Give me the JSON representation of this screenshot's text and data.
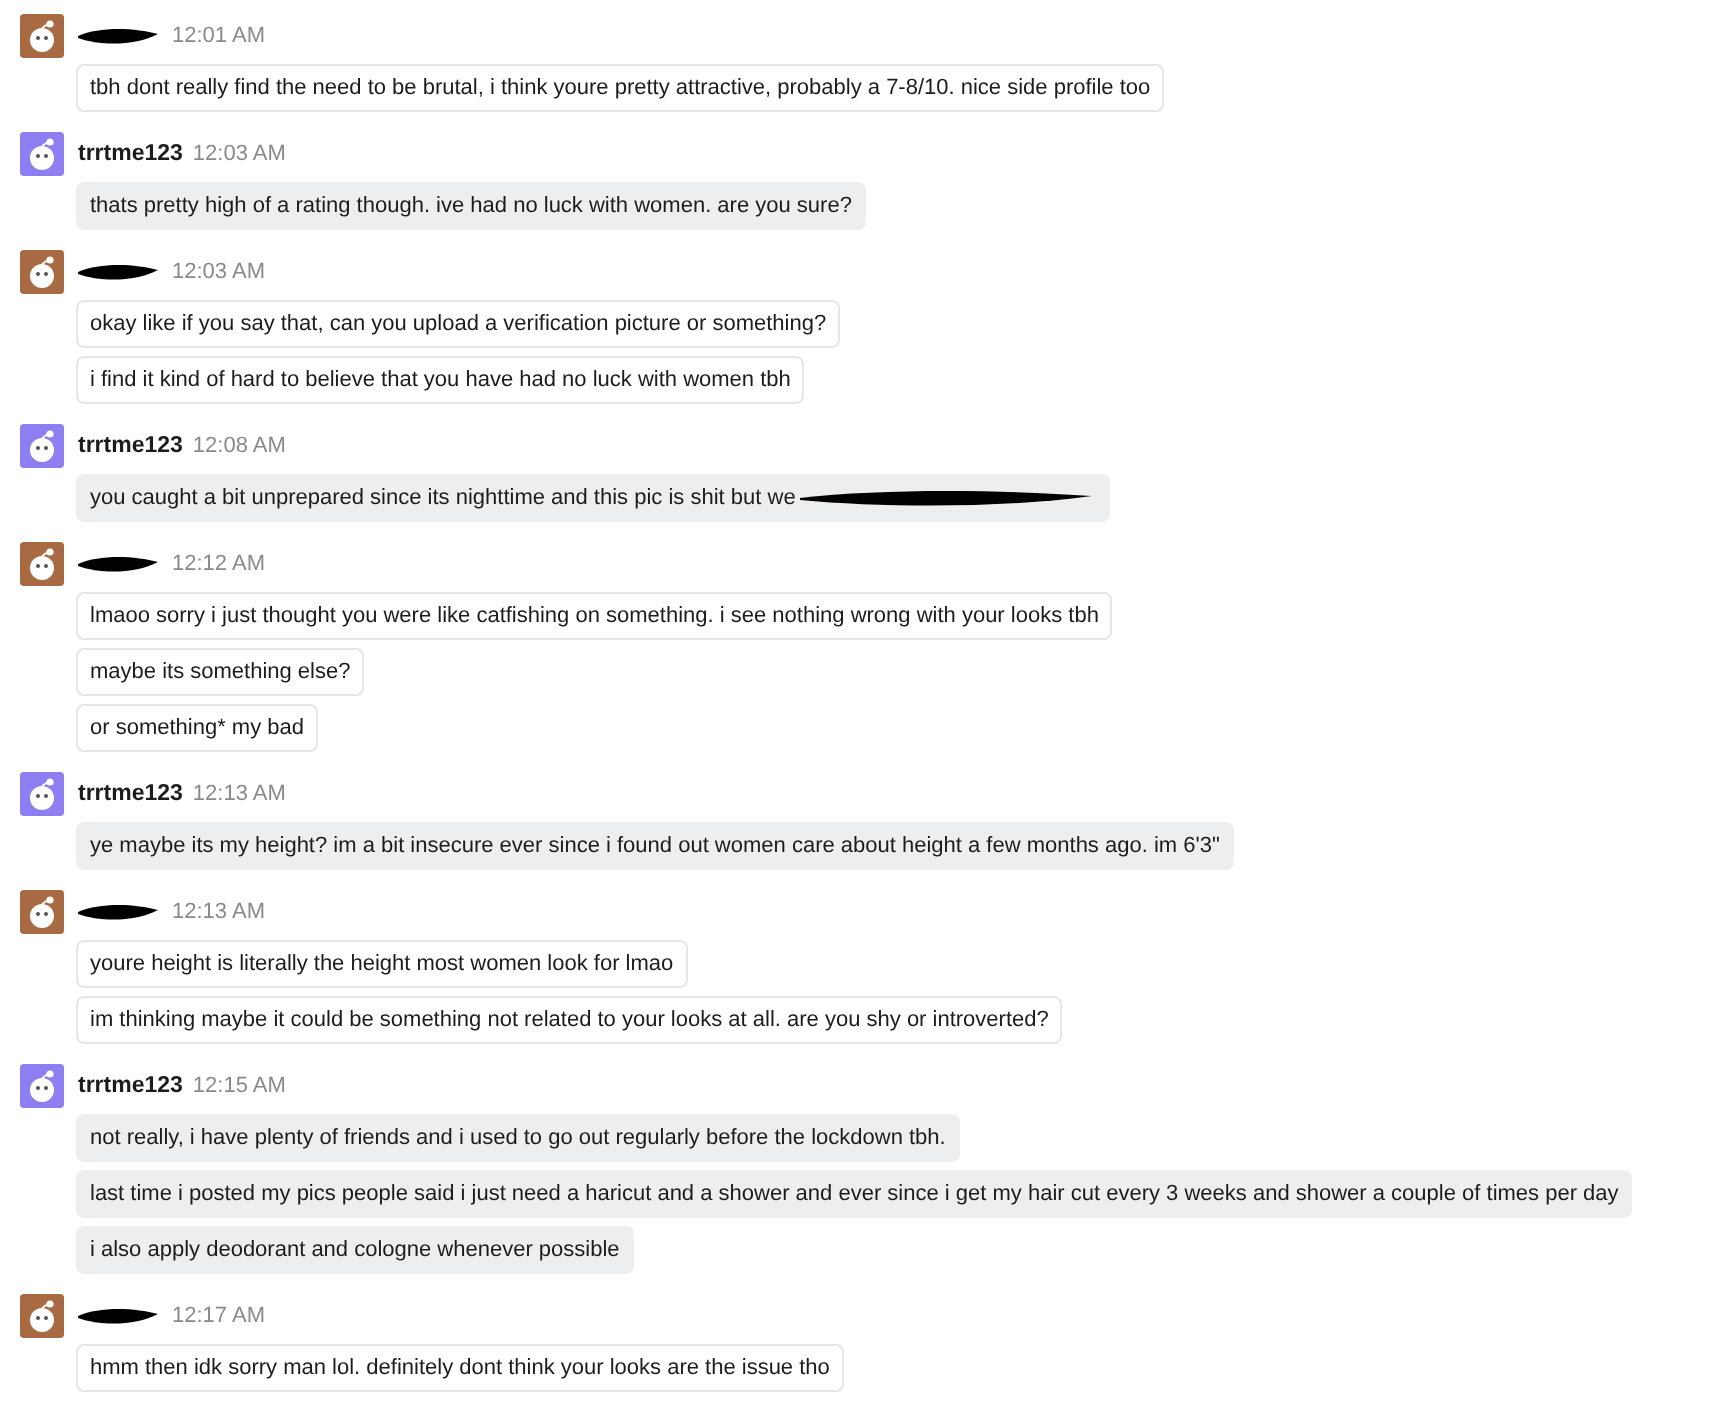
{
  "groups": [
    {
      "kind": "other",
      "name_redacted": true,
      "time": "12:01 AM",
      "messages": [
        {
          "text": "tbh dont really find the need to be brutal, i think youre pretty attractive, probably a 7-8/10. nice side profile too",
          "redacted": false
        }
      ]
    },
    {
      "kind": "self",
      "name": "trrtme123",
      "time": "12:03 AM",
      "messages": [
        {
          "text": "thats pretty high of a rating though. ive had no luck with women. are you sure?",
          "redacted": false
        }
      ]
    },
    {
      "kind": "other",
      "name_redacted": true,
      "time": "12:03 AM",
      "messages": [
        {
          "text": "okay like if you say that, can you upload a verification picture or something?",
          "redacted": false
        },
        {
          "text": "i find it kind of hard to believe that you have had no luck with women tbh",
          "redacted": false
        }
      ]
    },
    {
      "kind": "self",
      "name": "trrtme123",
      "time": "12:08 AM",
      "messages": [
        {
          "text": "you caught a bit unprepared since its nighttime and this pic is shit but we",
          "redacted": true
        }
      ]
    },
    {
      "kind": "other",
      "name_redacted": true,
      "time": "12:12 AM",
      "messages": [
        {
          "text": "lmaoo sorry i just thought you were like catfishing on something. i see nothing wrong with your looks tbh",
          "redacted": false
        },
        {
          "text": "maybe its something else?",
          "redacted": false
        },
        {
          "text": "or something* my bad",
          "redacted": false
        }
      ]
    },
    {
      "kind": "self",
      "name": "trrtme123",
      "time": "12:13 AM",
      "messages": [
        {
          "text": "ye maybe its my height? im a bit insecure ever since i found out women care about height a few months ago. im 6'3\"",
          "redacted": false
        }
      ]
    },
    {
      "kind": "other",
      "name_redacted": true,
      "time": "12:13 AM",
      "messages": [
        {
          "text": "youre height is literally the height most women look for lmao",
          "redacted": false
        },
        {
          "text": "im thinking maybe it could be something not related to your looks at all. are you shy or introverted?",
          "redacted": false
        }
      ]
    },
    {
      "kind": "self",
      "name": "trrtme123",
      "time": "12:15 AM",
      "messages": [
        {
          "text": "not really, i have plenty of friends and i used to go out regularly before the lockdown tbh.",
          "redacted": false
        },
        {
          "text": "last time i posted my pics people said i just need a haricut and a shower and ever since i get my hair cut every 3 weeks and shower a couple of times per day",
          "redacted": false
        },
        {
          "text": "i also apply deodorant and cologne whenever possible",
          "redacted": false
        }
      ]
    },
    {
      "kind": "other",
      "name_redacted": true,
      "time": "12:17 AM",
      "messages": [
        {
          "text": "hmm then idk sorry man lol. definitely dont think your looks are the issue tho",
          "redacted": false
        }
      ]
    }
  ]
}
